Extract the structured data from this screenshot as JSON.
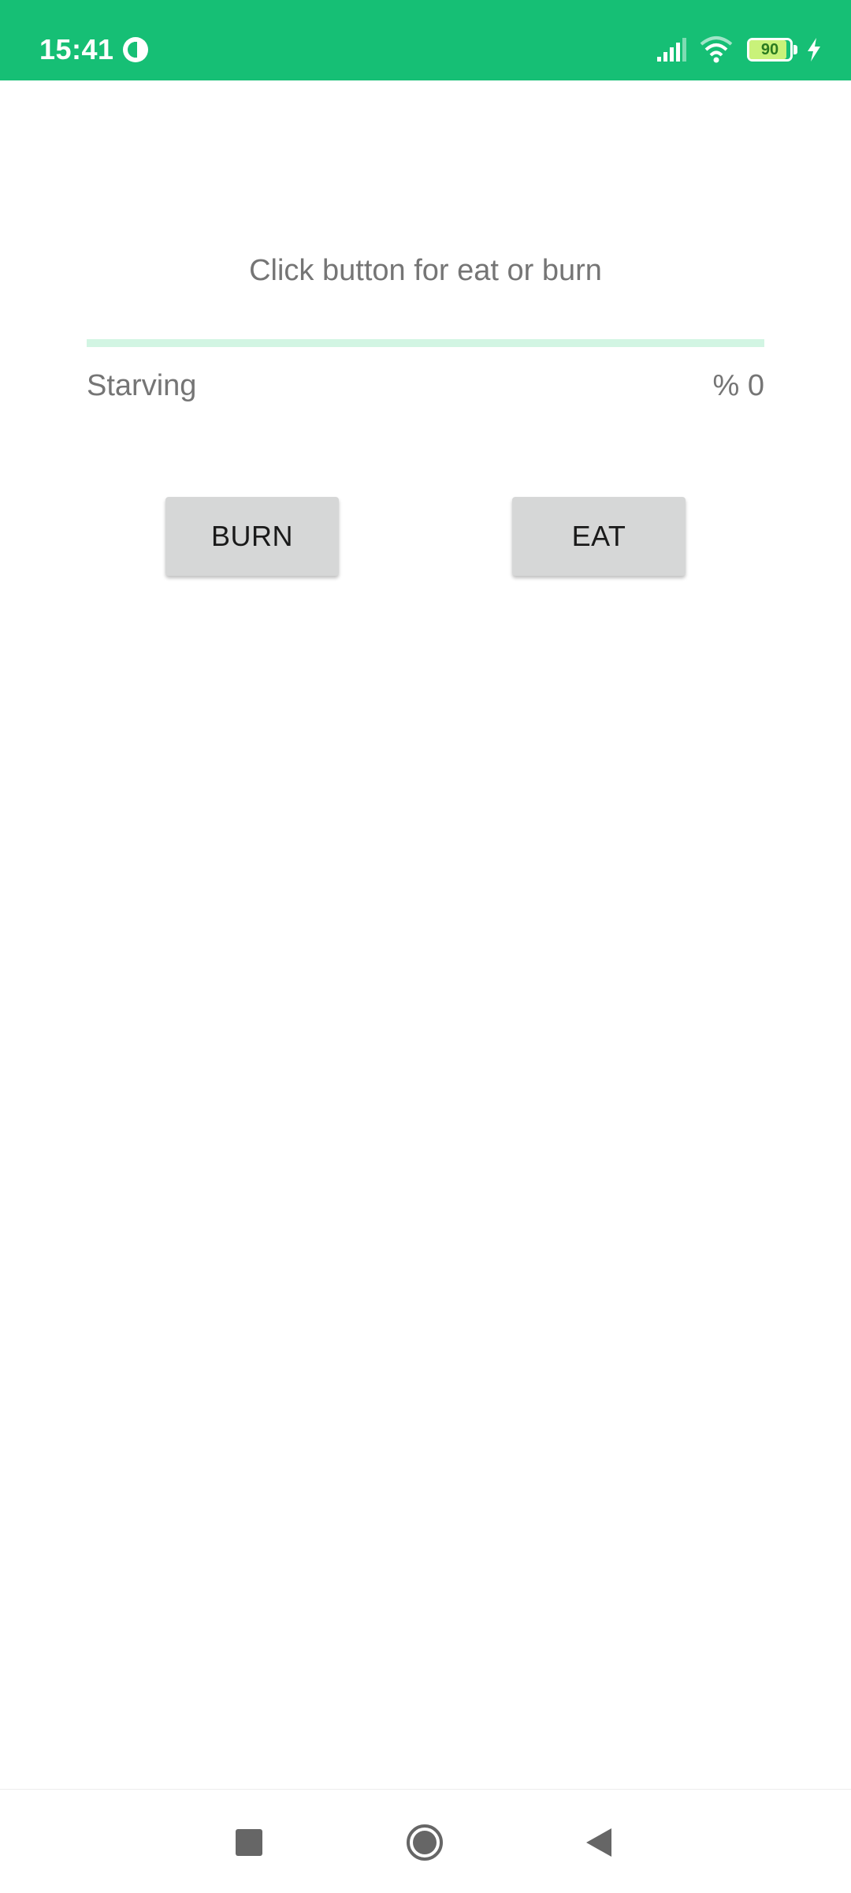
{
  "status_bar": {
    "time": "15:41",
    "battery_level": "90",
    "battery_percent": 90,
    "background_color": "#16bf75",
    "icons": [
      "app-notification-icon",
      "signal-icon",
      "wifi-icon",
      "battery-icon",
      "charging-icon"
    ]
  },
  "main": {
    "instruction": "Click button for eat or burn",
    "status_label": "Starving",
    "percent_label": "% 0",
    "progress_value": 0,
    "progress_track_color": "#d2f5e3",
    "progress_fill_color": "#16bf75"
  },
  "buttons": {
    "burn_label": "BURN",
    "eat_label": "EAT"
  },
  "nav_bar": {
    "icons": [
      "recents-icon",
      "home-icon",
      "back-icon"
    ]
  }
}
